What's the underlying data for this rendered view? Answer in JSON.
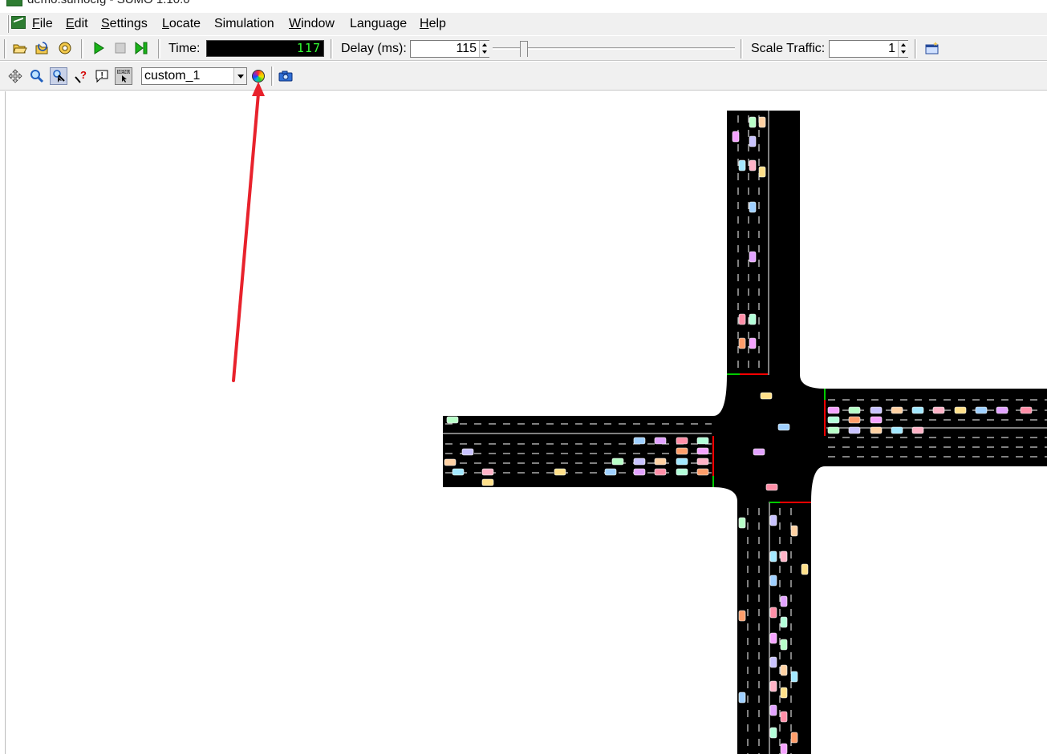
{
  "window": {
    "title": "demo.sumocfg - SUMO 1.10.0"
  },
  "menu": {
    "items": [
      {
        "label": "File",
        "accel": "F"
      },
      {
        "label": "Edit",
        "accel": "E"
      },
      {
        "label": "Settings",
        "accel": "S"
      },
      {
        "label": "Locate",
        "accel": "L"
      },
      {
        "label": "Simulation",
        "accel": ""
      },
      {
        "label": "Window",
        "accel": "W"
      },
      {
        "label": "Language",
        "accel": ""
      },
      {
        "label": "Help",
        "accel": "H"
      }
    ]
  },
  "toolbar": {
    "time_label": "Time:",
    "time_value": "117",
    "delay_label": "Delay (ms):",
    "delay_value": "115",
    "delay_slider_fraction": 0.115,
    "scale_label": "Scale Traffic:",
    "scale_value": "1"
  },
  "view_toolbar": {
    "scheme_value": "custom_1",
    "edit_coloring_tooltip_target": "color-wheel-icon"
  },
  "icons": {
    "open": "open-folder-icon",
    "reload": "reload-icon",
    "recent": "recent-icon",
    "run": "play-icon",
    "stop": "stop-icon",
    "step": "step-icon",
    "new_view": "new-view-icon",
    "recenter": "recenter-icon",
    "zoom": "magnifier-icon",
    "locate": "locate-icon",
    "help": "help-icon",
    "messages": "message-icon",
    "menu": "menu-icon",
    "coloring": "color-wheel-icon",
    "screenshot": "camera-icon"
  },
  "colors": {
    "road": "#000000",
    "lane_mark": "#ffffff",
    "signal_green": "#00cc00",
    "signal_red": "#ff0000",
    "annotation_arrow": "#e8222c",
    "time_digits": "#33ff33"
  },
  "annotation": {
    "type": "arrow",
    "points_to": "color-wheel-icon"
  }
}
